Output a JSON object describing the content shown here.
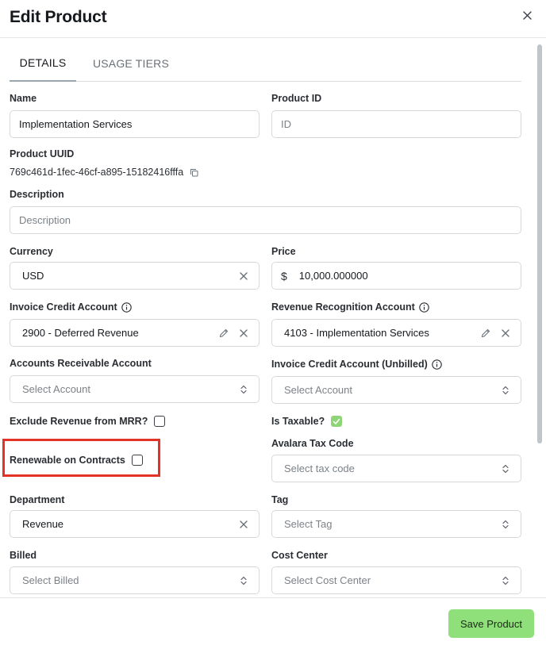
{
  "header": {
    "title": "Edit Product"
  },
  "tabs": [
    {
      "label": "DETAILS"
    },
    {
      "label": "USAGE TIERS"
    }
  ],
  "fields": {
    "name": {
      "label": "Name",
      "value": "Implementation Services"
    },
    "product_id": {
      "label": "Product ID",
      "placeholder": "ID"
    },
    "product_uuid": {
      "label": "Product UUID",
      "value": "769c461d-1fec-46cf-a895-15182416fffa"
    },
    "description": {
      "label": "Description",
      "placeholder": "Description"
    },
    "currency": {
      "label": "Currency",
      "value": "USD"
    },
    "price": {
      "label": "Price",
      "prefix": "$",
      "value": "10,000.000000"
    },
    "invoice_credit_account": {
      "label": "Invoice Credit Account",
      "value": "2900 - Deferred Revenue"
    },
    "revenue_recognition_account": {
      "label": "Revenue Recognition Account",
      "value": "4103 - Implementation Services"
    },
    "accounts_receivable_account": {
      "label": "Accounts Receivable Account",
      "placeholder": "Select Account"
    },
    "invoice_credit_account_unbilled": {
      "label": "Invoice Credit Account (Unbilled)",
      "placeholder": "Select Account"
    },
    "exclude_revenue_mrr": {
      "label": "Exclude Revenue from MRR?",
      "checked": false
    },
    "is_taxable": {
      "label": "Is Taxable?",
      "checked": true
    },
    "renewable_on_contracts": {
      "label": "Renewable on Contracts",
      "checked": false
    },
    "avalara_tax_code": {
      "label": "Avalara Tax Code",
      "placeholder": "Select tax code"
    },
    "department": {
      "label": "Department",
      "value": "Revenue"
    },
    "tag": {
      "label": "Tag",
      "placeholder": "Select Tag"
    },
    "billed": {
      "label": "Billed",
      "placeholder": "Select Billed"
    },
    "cost_center": {
      "label": "Cost Center",
      "placeholder": "Select Cost Center"
    }
  },
  "footer": {
    "save_label": "Save Product"
  },
  "colors": {
    "accent": "#8fe07a",
    "checked": "#8fd477",
    "highlight": "#e33326"
  }
}
